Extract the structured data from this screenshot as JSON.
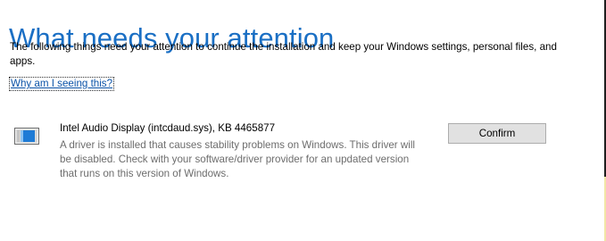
{
  "header": {
    "title": "What needs your attention"
  },
  "intro": {
    "text": "The following things need your attention to continue the installation and keep your Windows settings, personal files, and apps."
  },
  "why_link": {
    "label": "Why am I seeing this?"
  },
  "item": {
    "icon": "driver-window-icon",
    "title": "Intel Audio Display (intcdaud.sys), KB 4465877",
    "description": "A driver is installed that causes stability problems on Windows. This driver will be disabled. Check with your software/driver provider for an updated version that runs on this version of Windows.",
    "confirm_label": "Confirm"
  },
  "colors": {
    "title": "#1a6fc4",
    "link": "#0b53a8",
    "description": "#6d6d6d",
    "button_face": "#e1e1e1",
    "button_border": "#adadad",
    "icon_blue": "#1e7bd6"
  }
}
